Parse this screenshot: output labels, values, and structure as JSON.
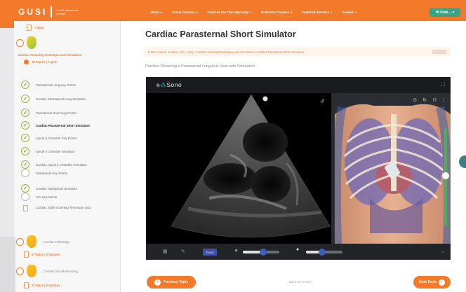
{
  "header": {
    "logo": "GUSI",
    "logo_sub": "Global Ultrasound Institute",
    "nav": [
      "About",
      "Focus Courses",
      "Courses For Your Specialty",
      "In-Person Courses",
      "Featured Services",
      "Contact"
    ],
    "user": "Hi Rubi..."
  },
  "sidebar": {
    "prev_meta": "7 Quiz",
    "topic_title": "Cardiac Scanning Technique and Simulation",
    "topic_meta": "18 Topics | 1 Quiz",
    "lessons": [
      {
        "label": "Parasternal Long Key Points",
        "done": true
      },
      {
        "label": "Cardiac Parasternal Long Simulator",
        "done": true
      },
      {
        "label": "Parasternal Short Key Points",
        "done": true
      },
      {
        "label": "Cardiac Parasternal Short Simulator",
        "done": true,
        "active": true
      },
      {
        "label": "Apical 4 Chamber Key Points",
        "done": true
      },
      {
        "label": "Apical 4 Chamber Simulator",
        "done": true
      },
      {
        "label": "Cardiac Apical 4 Chamber Simulator",
        "done": true
      },
      {
        "label": "Subxiphoid Key Points",
        "done": false
      },
      {
        "label": "Cardiac Subxiphoid Simulator",
        "done": true
      },
      {
        "label": "IVC Key Points",
        "done": false
      }
    ],
    "quiz_label": "Cardiac Slide Scanning Technique Quiz",
    "next_topics": [
      {
        "title": "Cardiac Pathology",
        "meta": "6 Topics | 2 Quizzes"
      },
      {
        "title": "Cardiac Troubleshooting",
        "meta": "3 Topics | 2 Quizzes"
      }
    ]
  },
  "main": {
    "title": "Cardiac Parasternal Short Simulator",
    "breadcrumb": "E-Bite Course: Cardiac, IVC, Lung > Cardiac Scanning Technique and Simulation > Cardiac Parasternal Short Simulator",
    "subtitle": "Practice Obtaining a Parasternal Long Axis View with Simulation",
    "sim_brand_a": "e",
    "sim_brand_b": "Sono",
    "toolbar_zoom": "Zoom",
    "prev_label": "Previous Topic",
    "back_label": "Back to Lesson",
    "next_label": "Next Topic"
  },
  "colors": {
    "accent": "#f37a2a",
    "user_button": "#3aa384",
    "check": "#9bb73a"
  }
}
